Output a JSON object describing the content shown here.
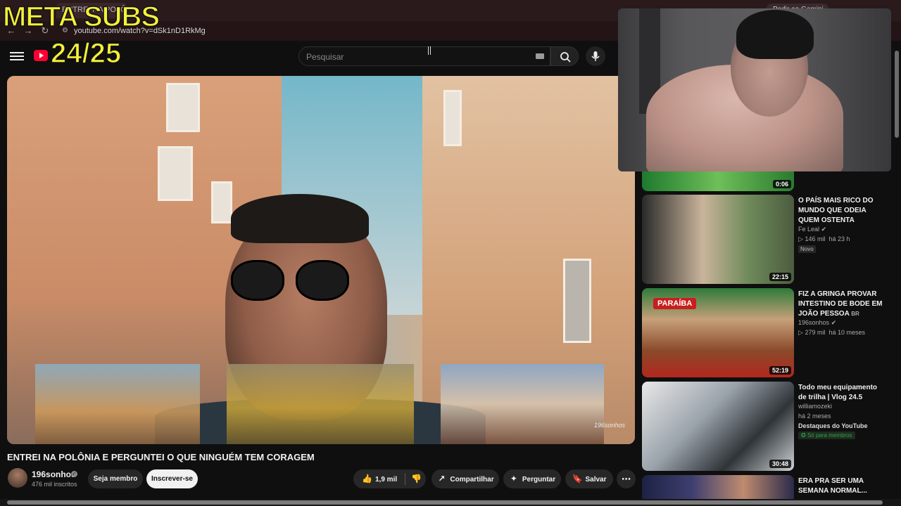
{
  "browser": {
    "tab_title": "ENTREI NA POLÔNIA E...",
    "url": "youtube.com/watch?v=dSk1nD1RkMg",
    "gemini_label": "Pedir ao Gemini"
  },
  "overlay": {
    "title": "META SUBS",
    "count": "24/25"
  },
  "search": {
    "placeholder": "Pesquisar"
  },
  "video": {
    "title": "ENTREI NA POLÔNIA E PERGUNTEI O QUE NINGUÉM TEM CORAGEM",
    "watermark": "196sonhos",
    "channel": "196sonhos",
    "subscribers": "476 mil inscritos",
    "member_label": "Seja membro",
    "subscribe_label": "Inscrever-se",
    "likes": "1,9 mil",
    "share_label": "Compartilhar",
    "ask_label": "Perguntar",
    "save_label": "Salvar"
  },
  "recommendations": [
    {
      "duration": "0:06"
    },
    {
      "title": "O PAÍS MAIS RICO DO MUNDO QUE ODEIA QUEM OSTENTA",
      "channel": "Fe Leal",
      "views": "146 mil",
      "age": "há 23 h",
      "badge": "Novo",
      "duration": "22:15"
    },
    {
      "title": "FIZ A GRINGA PROVAR INTESTINO DE BODE EM JOÃO PESSOA",
      "title_suffix": "BR",
      "channel": "196sonhos",
      "views": "279 mil",
      "age": "há 10 meses",
      "thumb_text": "PARAÍBA",
      "duration": "52:19"
    },
    {
      "title": "Todo meu equipamento de trilha | Vlog 24.5",
      "channel": "williamozeki",
      "age": "há 2 meses",
      "highlight": "Destaques do YouTube",
      "member_badge": "Só para membros",
      "duration": "30:48"
    },
    {
      "title": "ERA PRA SER UMA SEMANA NORMAL..."
    }
  ],
  "colors": {
    "background": "#0f0f0f",
    "overlay_yellow": "#f5f03a",
    "youtube_red": "#ff0033",
    "member_green": "#2ba640"
  }
}
